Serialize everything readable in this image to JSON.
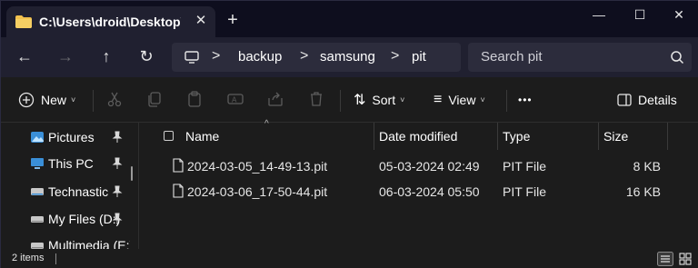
{
  "titlebar": {
    "tab_title": "C:\\Users\\droid\\Desktop\\backup\\samsung\\pit",
    "new_tab_glyph": "+",
    "close_tab_glyph": "✕",
    "minimize_glyph": "—",
    "maximize_glyph": "☐",
    "close_glyph": "✕"
  },
  "navigation": {
    "back_glyph": "←",
    "forward_glyph": "→",
    "up_glyph": "↑",
    "refresh_glyph": "↻"
  },
  "address": {
    "separator_glyph": ">",
    "crumbs": [
      "backup",
      "samsung",
      "pit"
    ]
  },
  "search": {
    "placeholder": "Search pit"
  },
  "toolbar": {
    "new_label": "New",
    "sort_label": "Sort",
    "view_label": "View",
    "more_glyph": "•••",
    "details_label": "Details",
    "caret_glyph": "˅"
  },
  "sidebar": {
    "items": [
      {
        "label": "Pictures",
        "icon": "pictures-icon"
      },
      {
        "label": "This PC",
        "icon": "this-pc-icon"
      },
      {
        "label": "Technastic",
        "icon": "drive-icon"
      },
      {
        "label": "My Files (D:)",
        "icon": "drive-icon"
      },
      {
        "label": "Multimedia (E:)",
        "icon": "drive-icon"
      }
    ]
  },
  "file_table": {
    "sort_indicator_glyph": "^",
    "columns": [
      "Name",
      "Date modified",
      "Type",
      "Size"
    ],
    "rows": [
      {
        "name": "2024-03-05_14-49-13.pit",
        "date": "05-03-2024 02:49",
        "type": "PIT File",
        "size": "8 KB"
      },
      {
        "name": "2024-03-06_17-50-44.pit",
        "date": "06-03-2024 05:50",
        "type": "PIT File",
        "size": "16 KB"
      }
    ]
  },
  "status": {
    "item_count": "2 items"
  },
  "colors": {
    "accent": "#4a9eda",
    "folder_yellow": "#f2c14e",
    "titlebar_bg": "#0e0e1e",
    "navbar_bg": "#202030",
    "content_bg": "#1c1c1c"
  }
}
